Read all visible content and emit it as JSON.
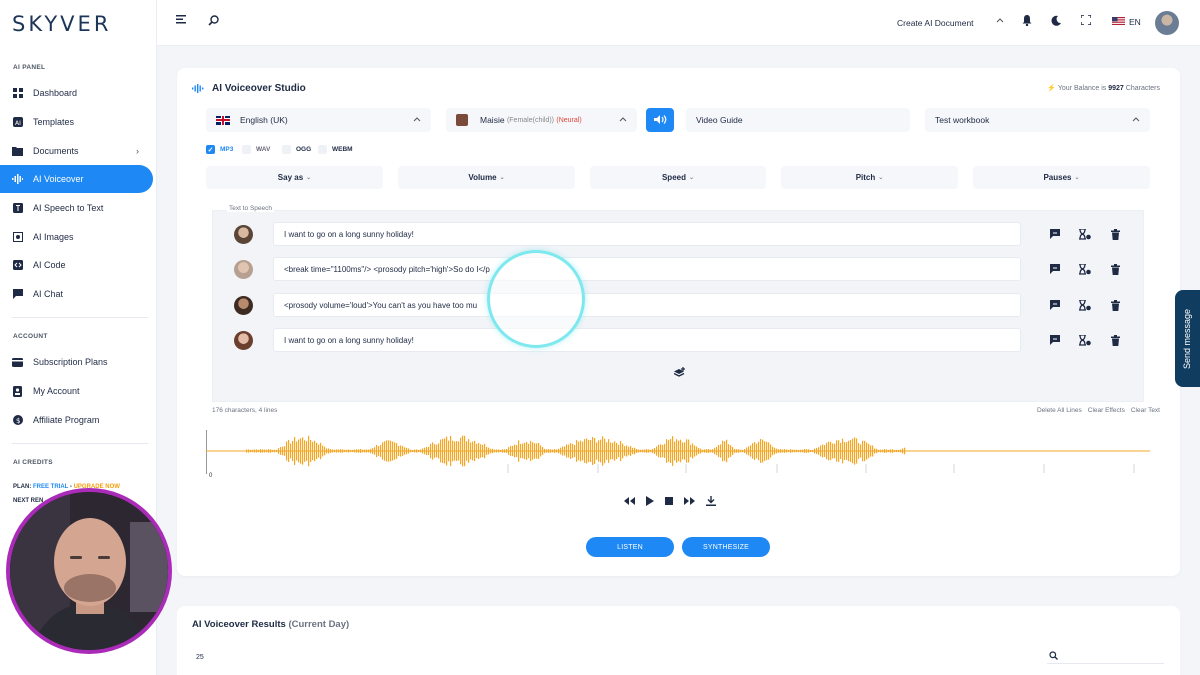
{
  "app": {
    "logo": "SKYVER"
  },
  "sidebar": {
    "panel_heading": "AI PANEL",
    "items": [
      {
        "label": "Dashboard",
        "icon": "dashboard-icon"
      },
      {
        "label": "Templates",
        "icon": "templates-icon"
      },
      {
        "label": "Documents",
        "icon": "documents-icon",
        "has_submenu": true
      },
      {
        "label": "AI Voiceover",
        "icon": "waveform-icon",
        "active": true
      },
      {
        "label": "AI Speech to Text",
        "icon": "speech-to-text-icon"
      },
      {
        "label": "AI Images",
        "icon": "image-icon"
      },
      {
        "label": "AI Code",
        "icon": "code-icon"
      },
      {
        "label": "AI Chat",
        "icon": "chat-icon"
      }
    ],
    "account_heading": "ACCOUNT",
    "account_items": [
      {
        "label": "Subscription Plans",
        "icon": "subscription-icon"
      },
      {
        "label": "My Account",
        "icon": "account-icon"
      },
      {
        "label": "Affiliate Program",
        "icon": "affiliate-icon"
      }
    ],
    "credits_heading": "AI CREDITS",
    "plan_prefix": "PLAN:",
    "plan_name": "FREE TRIAL",
    "plan_sep": "-",
    "upgrade_label": "UPGRADE NOW",
    "next_renew": "NEXT REN"
  },
  "topbar": {
    "create_doc_label": "Create AI Document",
    "lang_label": "EN"
  },
  "studio": {
    "title": "AI Voiceover Studio",
    "balance_prefix": "Your Balance is",
    "balance_value": "9927",
    "balance_suffix": "Characters",
    "language": "English (UK)",
    "voice_name": "Maisie",
    "voice_type": "(Female(child))",
    "voice_engine": "(Neural)",
    "video_guide": "Video Guide",
    "workbook": "Test workbook",
    "formats": [
      {
        "label": "MP3",
        "checked": true
      },
      {
        "label": "WAV",
        "checked": false
      },
      {
        "label": "OGG",
        "checked": false
      },
      {
        "label": "WEBM",
        "checked": false
      }
    ],
    "effects": [
      "Say as",
      "Volume",
      "Speed",
      "Pitch",
      "Pauses"
    ],
    "tts_label": "Text to Speech",
    "lines": [
      "I want to go on a long sunny holiday!",
      "<break time=\"1100ms\"/> <prosody pitch='high'>So do I</p",
      "<prosody volume='loud'>You can't as you have too mu",
      "I want to go on a long sunny holiday!"
    ],
    "char_count": "176 characters, 4 lines",
    "clear_links": [
      "Delete All Lines",
      "Clear Effects",
      "Clear Text"
    ],
    "wave_zero": "0",
    "listen_label": "LISTEN",
    "synthesize_label": "SYNTHESIZE",
    "accent_color": "#1e88f5",
    "wave_color": "#f5a623"
  },
  "results": {
    "title": "AI Voiceover Results",
    "subtitle": "(Current Day)",
    "show_count": "25"
  },
  "send_message": "Send message"
}
